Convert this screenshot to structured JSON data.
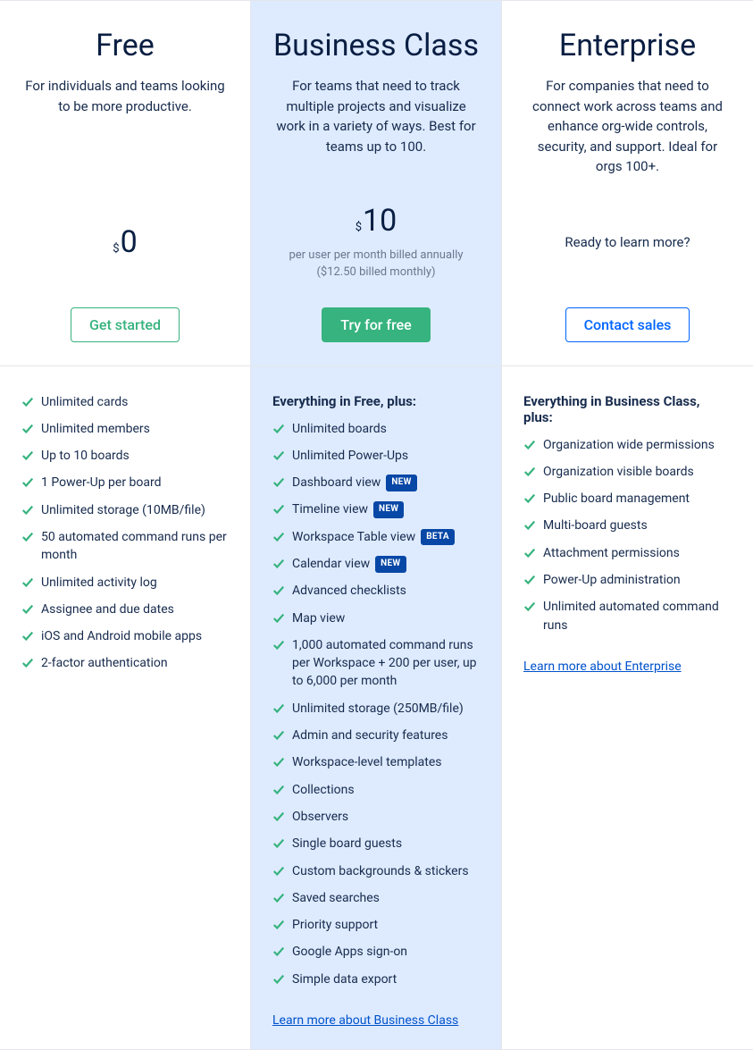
{
  "plans": [
    {
      "title": "Free",
      "desc": "For individuals and teams looking to be more productive.",
      "currency": "$",
      "price": "0",
      "price_sub": "",
      "cta": "Get started",
      "cta_style": "outline-green"
    },
    {
      "title": "Business Class",
      "desc": "For teams that need to track multiple projects and visualize work in a variety of ways. Best for teams up to 100.",
      "currency": "$",
      "price": "10",
      "price_sub": "per user per month billed annually ($12.50 billed monthly)",
      "cta": "Try for free",
      "cta_style": "green"
    },
    {
      "title": "Enterprise",
      "desc": "For companies that need to connect work across teams and enhance org-wide controls, security, and support. Ideal for orgs 100+.",
      "ready_text": "Ready to learn more?",
      "cta": "Contact sales",
      "cta_style": "outline-blue"
    }
  ],
  "feature_columns": [
    {
      "heading": "",
      "items": [
        {
          "text": "Unlimited cards"
        },
        {
          "text": "Unlimited members"
        },
        {
          "text": "Up to 10 boards"
        },
        {
          "text": "1 Power-Up per board"
        },
        {
          "text": "Unlimited storage (10MB/file)"
        },
        {
          "text": "50 automated command runs per month"
        },
        {
          "text": "Unlimited activity log"
        },
        {
          "text": "Assignee and due dates"
        },
        {
          "text": "iOS and Android mobile apps"
        },
        {
          "text": "2-factor authentication"
        }
      ],
      "learn_more": ""
    },
    {
      "heading": "Everything in Free, plus:",
      "items": [
        {
          "text": "Unlimited boards"
        },
        {
          "text": "Unlimited Power-Ups"
        },
        {
          "text": "Dashboard view",
          "badge": "NEW"
        },
        {
          "text": "Timeline view",
          "badge": "NEW"
        },
        {
          "text": "Workspace Table view",
          "badge": "BETA"
        },
        {
          "text": "Calendar view",
          "badge": "NEW"
        },
        {
          "text": "Advanced checklists"
        },
        {
          "text": "Map view"
        },
        {
          "text": "1,000 automated command runs per Workspace + 200 per user, up to 6,000 per month"
        },
        {
          "text": "Unlimited storage (250MB/file)"
        },
        {
          "text": "Admin and security features"
        },
        {
          "text": "Workspace-level templates"
        },
        {
          "text": "Collections"
        },
        {
          "text": "Observers"
        },
        {
          "text": "Single board guests"
        },
        {
          "text": "Custom backgrounds & stickers"
        },
        {
          "text": "Saved searches"
        },
        {
          "text": "Priority support"
        },
        {
          "text": "Google Apps sign-on"
        },
        {
          "text": "Simple data export"
        }
      ],
      "learn_more": "Learn more about Business Class"
    },
    {
      "heading": "Everything in Business Class, plus:",
      "items": [
        {
          "text": "Organization wide permissions"
        },
        {
          "text": "Organization visible boards"
        },
        {
          "text": "Public board management"
        },
        {
          "text": "Multi-board guests"
        },
        {
          "text": "Attachment permissions"
        },
        {
          "text": "Power-Up administration"
        },
        {
          "text": "Unlimited automated command runs"
        }
      ],
      "learn_more": "Learn more about Enterprise"
    }
  ]
}
